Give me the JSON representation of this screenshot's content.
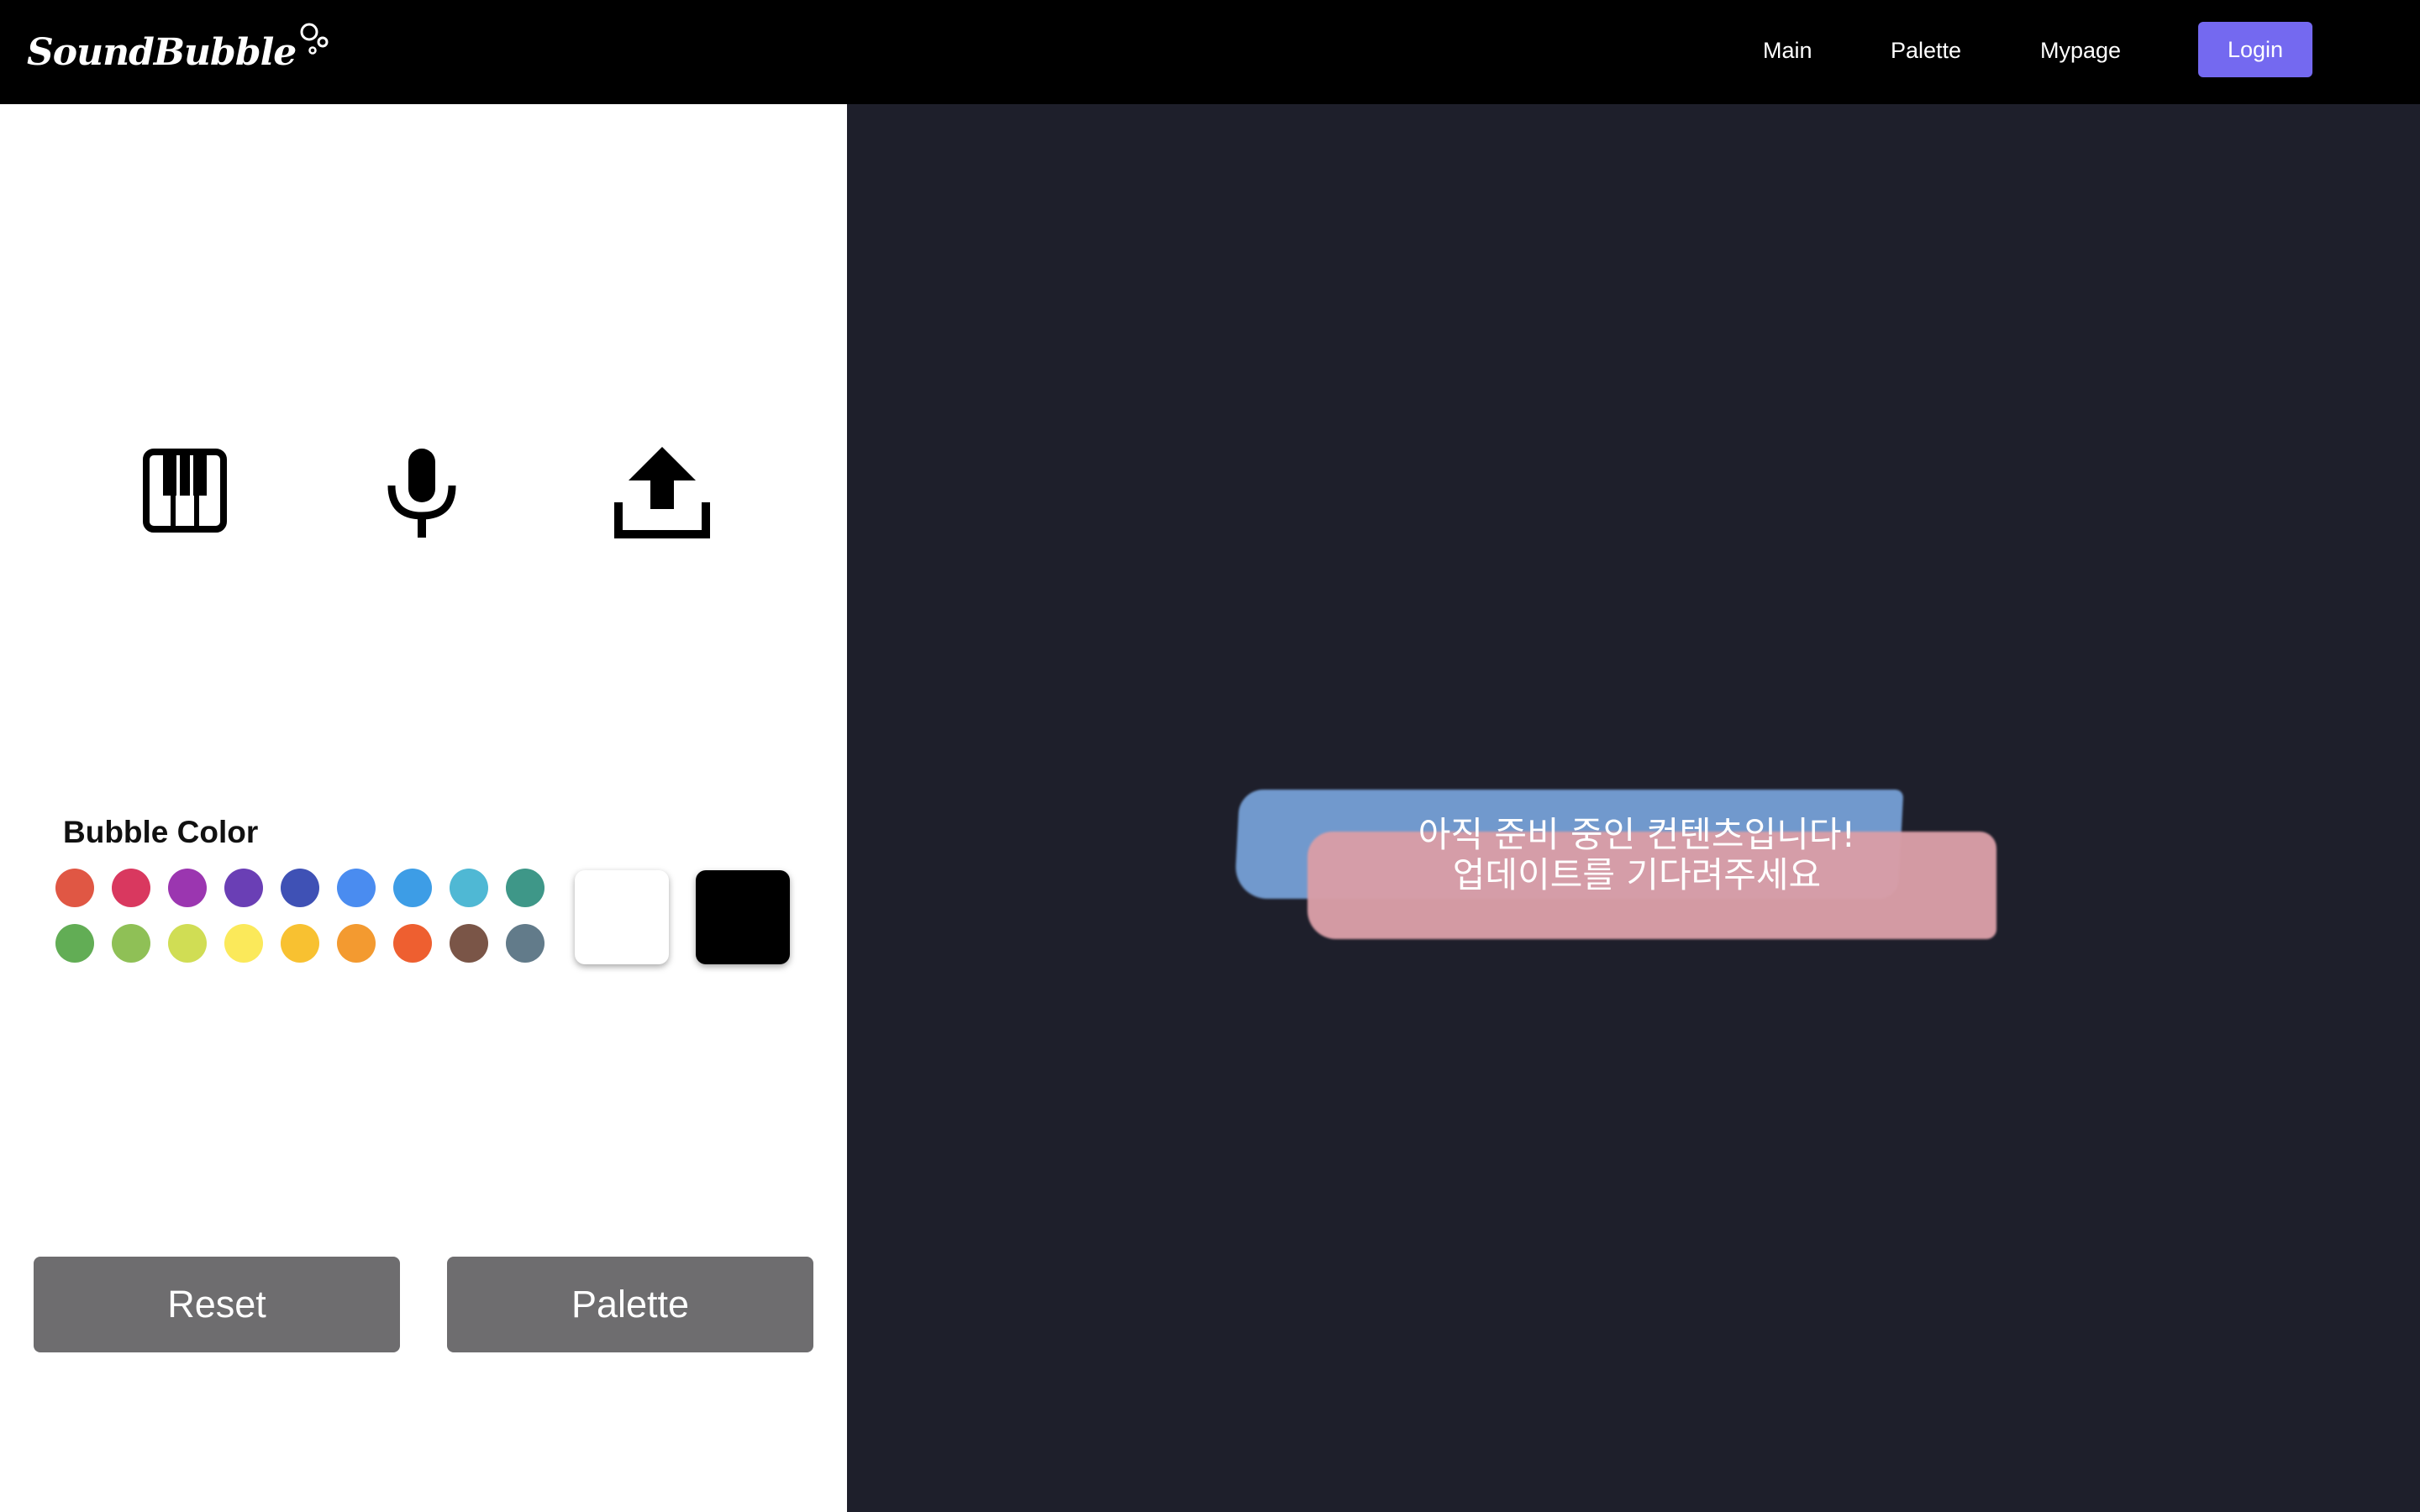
{
  "header": {
    "logo_text": "SoundBubble",
    "nav": [
      "Main",
      "Palette",
      "Mypage"
    ],
    "login_label": "Login",
    "login_color": "#7469f0"
  },
  "tools": {
    "icons": [
      "piano-icon",
      "microphone-icon",
      "upload-icon"
    ]
  },
  "bubble_color": {
    "title": "Bubble Color",
    "row1": [
      "#e05744",
      "#d9385f",
      "#9b36b0",
      "#6a3fb5",
      "#3f51b5",
      "#4a8cf0",
      "#3d9de6",
      "#4fb8d4",
      "#3e9788"
    ],
    "row2": [
      "#62ad55",
      "#8fc056",
      "#d0dd54",
      "#fbe95a",
      "#f8c131",
      "#f39a30",
      "#ee5f30",
      "#7a5547",
      "#627b8a"
    ],
    "large": [
      "#ffffff",
      "#000000"
    ]
  },
  "actions": {
    "reset_label": "Reset",
    "palette_label": "Palette"
  },
  "stage": {
    "line1": "아직 준비 중인 컨텐츠입니다!",
    "line2": "업데이트를 기다려주세요",
    "background": "#1e1f2b"
  }
}
